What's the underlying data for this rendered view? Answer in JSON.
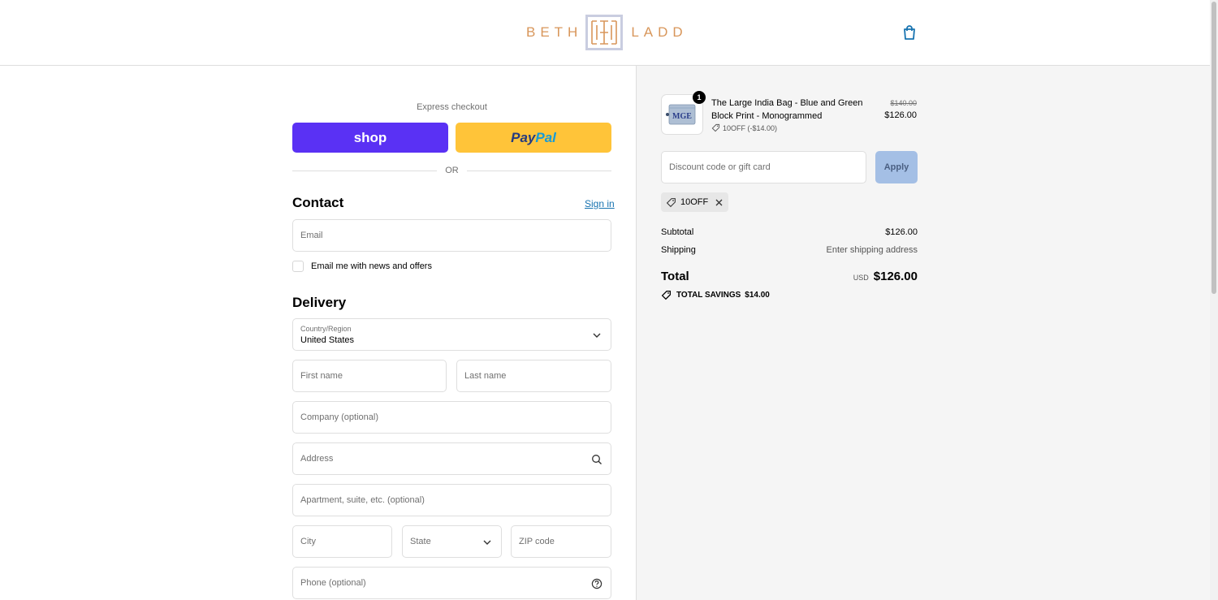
{
  "brand": {
    "name_left": "BETH",
    "name_right": "LADD",
    "accent_color": "#d8965a"
  },
  "express": {
    "label": "Express checkout",
    "shop_label": "shop",
    "paypal_label_dark": "Pay",
    "paypal_label_light": "Pal",
    "or_label": "OR"
  },
  "contact": {
    "title": "Contact",
    "sign_in": "Sign in",
    "email_placeholder": "Email",
    "news_label": "Email me with news and offers"
  },
  "delivery": {
    "title": "Delivery",
    "country_label": "Country/Region",
    "country_value": "United States",
    "first_name": "First name",
    "last_name": "Last name",
    "company": "Company (optional)",
    "address": "Address",
    "apartment": "Apartment, suite, etc. (optional)",
    "city": "City",
    "state": "State",
    "zip": "ZIP code",
    "phone": "Phone (optional)"
  },
  "summary": {
    "product": {
      "qty": "1",
      "name": "The Large India Bag - Blue and Green Block Print - Monogrammed",
      "discount": "10OFF (-$14.00)",
      "original_price": "$140.00",
      "price": "$126.00",
      "thumb_text": "MGE"
    },
    "discount_placeholder": "Discount code or gift card",
    "apply_label": "Apply",
    "applied_code": "10OFF",
    "subtotal_label": "Subtotal",
    "subtotal_value": "$126.00",
    "shipping_label": "Shipping",
    "shipping_value": "Enter shipping address",
    "total_label": "Total",
    "currency": "USD",
    "total_value": "$126.00",
    "savings_label": "TOTAL SAVINGS",
    "savings_value": "$14.00"
  },
  "icons": {
    "cart": "shopping-bag-icon",
    "search": "search-icon",
    "help": "question-circle-icon",
    "chevron": "chevron-down-icon",
    "tag": "tag-icon",
    "close": "close-icon"
  }
}
